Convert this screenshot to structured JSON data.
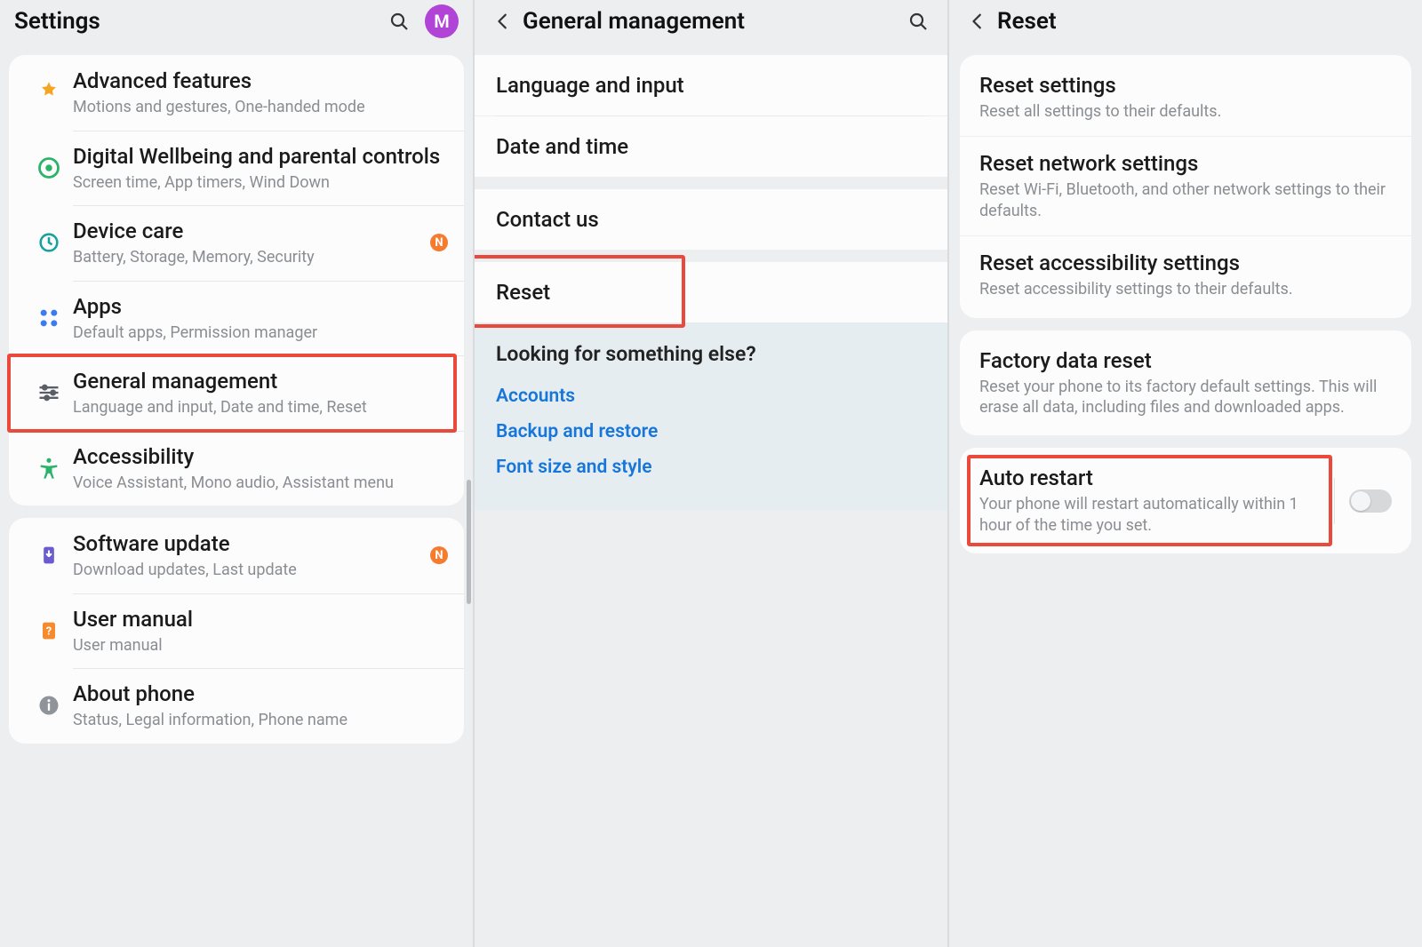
{
  "panel1": {
    "title": "Settings",
    "avatar": "M",
    "groups": [
      {
        "items": [
          {
            "icon": "advanced",
            "title": "Advanced features",
            "sub": "Motions and gestures, One-handed mode"
          },
          {
            "icon": "wellbeing",
            "title": "Digital Wellbeing and parental controls",
            "sub": "Screen time, App timers, Wind Down"
          },
          {
            "icon": "devicecare",
            "title": "Device care",
            "sub": "Battery, Storage, Memory, Security",
            "badge": "N"
          },
          {
            "icon": "apps",
            "title": "Apps",
            "sub": "Default apps, Permission manager"
          },
          {
            "icon": "general",
            "title": "General management",
            "sub": "Language and input, Date and time, Reset",
            "highlight": true
          },
          {
            "icon": "accessibility",
            "title": "Accessibility",
            "sub": "Voice Assistant, Mono audio, Assistant menu"
          }
        ]
      },
      {
        "items": [
          {
            "icon": "update",
            "title": "Software update",
            "sub": "Download updates, Last update",
            "badge": "N"
          },
          {
            "icon": "manual",
            "title": "User manual",
            "sub": "User manual"
          },
          {
            "icon": "about",
            "title": "About phone",
            "sub": "Status, Legal information, Phone name"
          }
        ]
      }
    ]
  },
  "panel2": {
    "title": "General management",
    "items": [
      {
        "label": "Language and input"
      },
      {
        "label": "Date and time"
      },
      {
        "label": "Contact us",
        "gapBefore": true
      },
      {
        "label": "Reset",
        "gapBefore": true,
        "highlight": true
      }
    ],
    "suggest": {
      "heading": "Looking for something else?",
      "links": [
        "Accounts",
        "Backup and restore",
        "Font size and style"
      ]
    }
  },
  "panel3": {
    "title": "Reset",
    "group1": [
      {
        "title": "Reset settings",
        "sub": "Reset all settings to their defaults."
      },
      {
        "title": "Reset network settings",
        "sub": "Reset Wi-Fi, Bluetooth, and other network settings to their defaults."
      },
      {
        "title": "Reset accessibility settings",
        "sub": "Reset accessibility settings to their defaults."
      }
    ],
    "group2": [
      {
        "title": "Factory data reset",
        "sub": "Reset your phone to its factory default settings. This will erase all data, including files and downloaded apps."
      }
    ],
    "auto": {
      "title": "Auto restart",
      "sub": "Your phone will restart automatically within 1 hour of the time you set.",
      "on": false
    }
  }
}
